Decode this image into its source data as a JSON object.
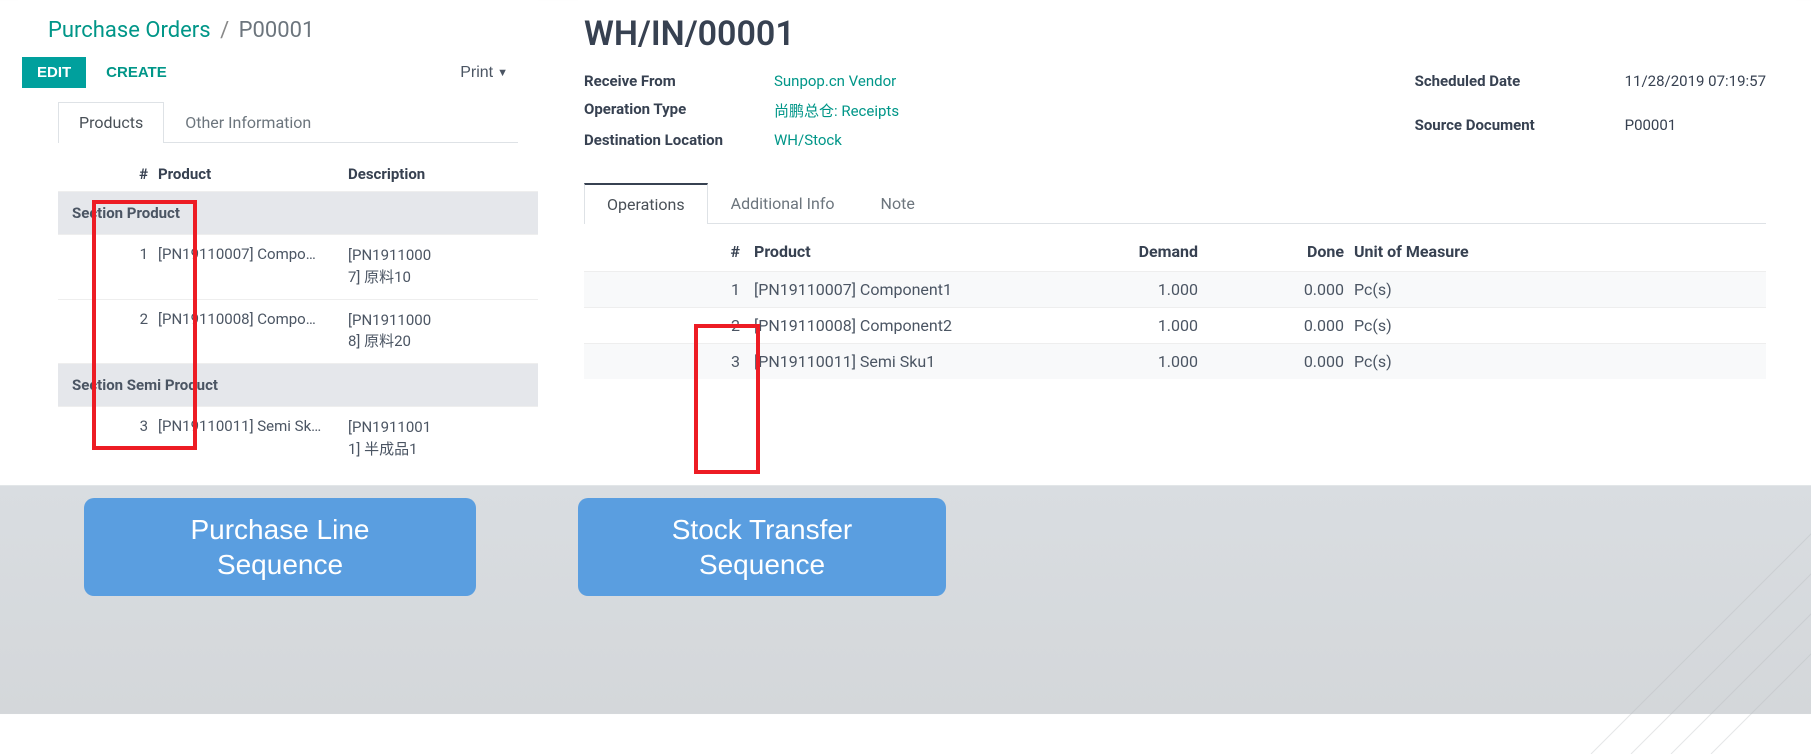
{
  "left": {
    "breadcrumb_root": "Purchase Orders",
    "breadcrumb_sep": "/",
    "breadcrumb_current": "P00001",
    "edit": "EDIT",
    "create": "CREATE",
    "print": "Print",
    "tabs": {
      "products": "Products",
      "other": "Other Information"
    },
    "headers": {
      "num": "#",
      "product": "Product",
      "description": "Description"
    },
    "section1": "Section Product",
    "row1": {
      "n": "1",
      "product": "[PN19110007] Compo…",
      "desc1": "[PN1911000",
      "desc2": "7] 原料10"
    },
    "row2": {
      "n": "2",
      "product": "[PN19110008] Compo…",
      "desc1": "[PN1911000",
      "desc2": "8] 原料20"
    },
    "section2": "Section Semi Product",
    "row3": {
      "n": "3",
      "product": "[PN19110011] Semi Sk…",
      "desc1": "[PN1911001",
      "desc2": "1] 半成品1"
    }
  },
  "right": {
    "title": "WH/IN/00001",
    "labels": {
      "receive_from": "Receive From",
      "operation_type": "Operation Type",
      "destination": "Destination Location",
      "scheduled": "Scheduled Date",
      "source_doc": "Source Document"
    },
    "values": {
      "receive_from": "Sunpop.cn Vendor",
      "operation_type": "尚鹏总仓: Receipts",
      "destination": "WH/Stock",
      "scheduled": "11/28/2019 07:19:57",
      "source_doc": "P00001"
    },
    "tabs": {
      "operations": "Operations",
      "additional": "Additional Info",
      "note": "Note"
    },
    "headers": {
      "num": "#",
      "product": "Product",
      "demand": "Demand",
      "done": "Done",
      "uom": "Unit of Measure"
    },
    "rows": [
      {
        "n": "1",
        "product": "[PN19110007] Component1",
        "demand": "1.000",
        "done": "0.000",
        "uom": "Pc(s)"
      },
      {
        "n": "2",
        "product": "[PN19110008] Component2",
        "demand": "1.000",
        "done": "0.000",
        "uom": "Pc(s)"
      },
      {
        "n": "3",
        "product": "[PN19110011] Semi Sku1",
        "demand": "1.000",
        "done": "0.000",
        "uom": "Pc(s)"
      }
    ]
  },
  "callouts": {
    "purchase_l1": "Purchase Line",
    "purchase_l2": "Sequence",
    "stock_l1": "Stock Transfer",
    "stock_l2": "Sequence"
  }
}
